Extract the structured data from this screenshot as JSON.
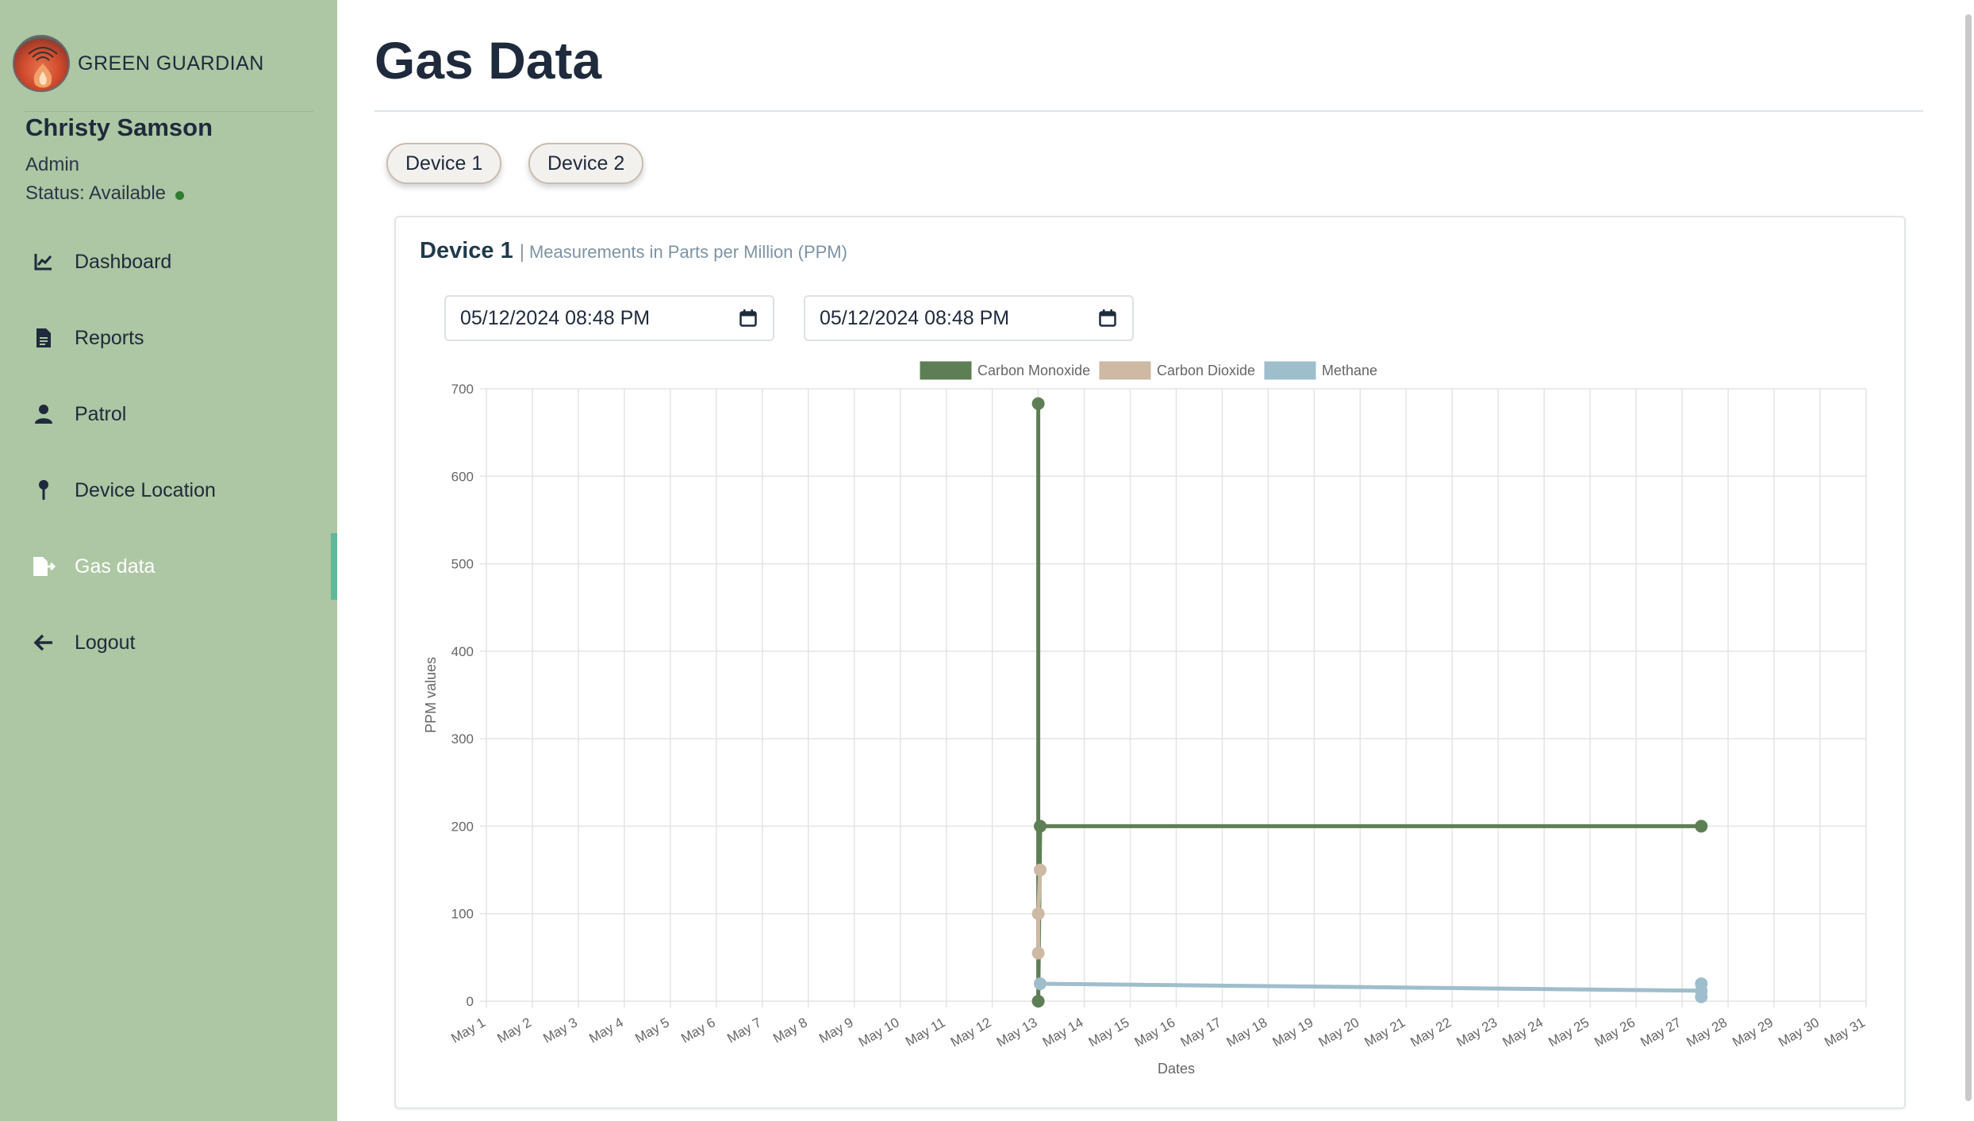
{
  "brand": {
    "name": "GREEN GUARDIAN"
  },
  "user": {
    "name": "Christy Samson",
    "role": "Admin",
    "status": "Status: Available"
  },
  "nav": {
    "items": [
      {
        "label": "Dashboard",
        "icon": "chart-line-icon"
      },
      {
        "label": "Reports",
        "icon": "document-icon"
      },
      {
        "label": "Patrol",
        "icon": "person-icon"
      },
      {
        "label": "Device Location",
        "icon": "map-pin-icon"
      },
      {
        "label": "Gas data",
        "icon": "file-export-icon",
        "active": true
      },
      {
        "label": "Logout",
        "icon": "arrow-left-icon"
      }
    ]
  },
  "page": {
    "title": "Gas Data"
  },
  "devices": {
    "device1": "Device 1",
    "device2": "Device 2"
  },
  "card": {
    "title": "Device 1",
    "separator": "|",
    "subtitle": "Measurements in Parts per Million (PPM)",
    "start_date": "05/12/2024 08:48  PM",
    "end_date": "05/12/2024 08:48  PM"
  },
  "colors": {
    "sidebar": "#adc6a3",
    "carbon_monoxide": "#5e7f55",
    "carbon_dioxide": "#cdb9a4",
    "methane": "#9fbecb",
    "active_indicator": "#5fb89a"
  },
  "chart_data": {
    "type": "line",
    "xlabel": "Dates",
    "ylabel": "PPM values",
    "ylim": [
      0,
      700
    ],
    "yticks": [
      0,
      100,
      200,
      300,
      400,
      500,
      600,
      700
    ],
    "xticks": [
      "May 1",
      "May 2",
      "May 3",
      "May 4",
      "May 5",
      "May 6",
      "May 7",
      "May 8",
      "May 9",
      "May 10",
      "May 11",
      "May 12",
      "May 13",
      "May 14",
      "May 15",
      "May 16",
      "May 17",
      "May 18",
      "May 19",
      "May 20",
      "May 21",
      "May 22",
      "May 23",
      "May 24",
      "May 25",
      "May 26",
      "May 27",
      "May 28",
      "May 29",
      "May 30",
      "May 31"
    ],
    "xlim": [
      "2024-05-01",
      "2024-05-31"
    ],
    "grid": true,
    "legend": "top",
    "series": [
      {
        "name": "Carbon Monoxide",
        "color": "#5e7f55",
        "points": [
          {
            "x": "2024-05-13T00:00",
            "y": 683
          },
          {
            "x": "2024-05-13T00:00",
            "y": 0
          },
          {
            "x": "2024-05-13T01:00",
            "y": 200
          },
          {
            "x": "2024-05-27T10:00",
            "y": 200
          }
        ]
      },
      {
        "name": "Carbon Dioxide",
        "color": "#cdb9a4",
        "points": [
          {
            "x": "2024-05-13T01:00",
            "y": 150
          },
          {
            "x": "2024-05-13T00:00",
            "y": 100
          },
          {
            "x": "2024-05-13T00:00",
            "y": 55
          }
        ]
      },
      {
        "name": "Methane",
        "color": "#9fbecb",
        "points": [
          {
            "x": "2024-05-13T01:00",
            "y": 20
          },
          {
            "x": "2024-05-27T10:00",
            "y": 12
          },
          {
            "x": "2024-05-27T10:00",
            "y": 20
          },
          {
            "x": "2024-05-27T10:00",
            "y": 5
          }
        ]
      }
    ]
  }
}
